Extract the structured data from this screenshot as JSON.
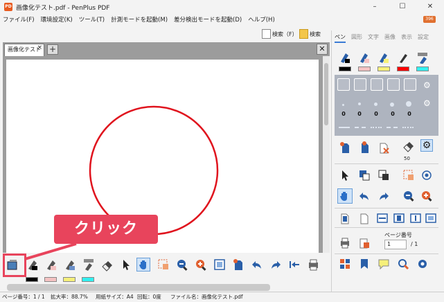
{
  "window": {
    "title": "画像化テスト.pdf - PenPlus PDF",
    "logo_text": "PD",
    "badge": "396",
    "controls": [
      "–",
      "☐",
      "✕"
    ]
  },
  "menu": [
    "ファイル(F)",
    "環境設定(K)",
    "ツール(T)",
    "計測モードを起動(M)",
    "差分検出モードを起動(D)",
    "ヘルプ(H)"
  ],
  "toolbar": {
    "search1": "検索（F）",
    "search2": "検索"
  },
  "tabs": {
    "doc_tab": "画像化テスト",
    "close": "×",
    "add": "+",
    "panel_close": "✕"
  },
  "canvas": {
    "shape": "circle",
    "stroke_color": "#e0141e"
  },
  "callout": {
    "label": "クリック",
    "color": "#e8445c"
  },
  "bottom_tools": [
    "image-pen-icon",
    "pen-icon",
    "marker-icon",
    "highlighter-icon",
    "eraser-pen-icon",
    "eraser-icon",
    "pointer-icon",
    "hand-icon",
    "select-area-icon",
    "zoom-out-icon",
    "zoom-in-icon",
    "page-view-icon",
    "insert-page-icon",
    "undo-icon",
    "redo-icon",
    "jump-back-icon",
    "print-icon"
  ],
  "bottom_swatches": [
    "#000000",
    "#f4c2c2",
    "#f6f07a",
    "#32f0f0"
  ],
  "right_panel": {
    "tabs": [
      "ペン",
      "図形",
      "文字",
      "画像",
      "表示",
      "設定"
    ],
    "active_tab": 0,
    "pen_colors": [
      "#000000",
      "#f4c2c2",
      "#f6f07a",
      "#ff0000",
      "#32f0f0"
    ],
    "width_values": [
      "0",
      "0",
      "0",
      "0",
      "0"
    ],
    "zoom_value": "50",
    "page_label": "ページ番号",
    "page_current": "1",
    "page_total": "/ 1"
  },
  "status": {
    "page": "ページ番号：1 / 1",
    "zoom": "拡大率：88.7%",
    "paper": "用紙サイズ：A4",
    "rotation": "回転：0度",
    "filename": "ファイル名：画像化テスト.pdf"
  }
}
